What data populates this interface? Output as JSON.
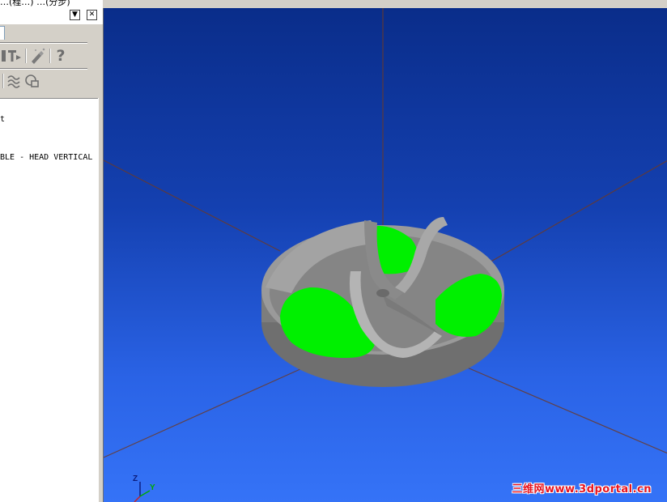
{
  "panel": {
    "title_fragment": "…(程…) …(分步)",
    "dropdown_glyph": "▼",
    "close_glyph": "✕",
    "tree_lines": [
      "t",
      "BLE - HEAD VERTICAL"
    ]
  },
  "toolbar1": {
    "icons": [
      "format-text-icon",
      "wand-icon",
      "help-icon"
    ],
    "help_glyph": "?"
  },
  "toolbar2": {
    "icons": [
      "waves-icon",
      "shapes-icon"
    ]
  },
  "viewport": {
    "background_top": "#0a2d8a",
    "background_bottom": "#3573f7",
    "part_color": "#8c8c8c",
    "highlight_color": "#00f000",
    "axis_triad": {
      "z": "Z",
      "y": "Y"
    },
    "watermark": "三维网www.3dportal.cn"
  }
}
